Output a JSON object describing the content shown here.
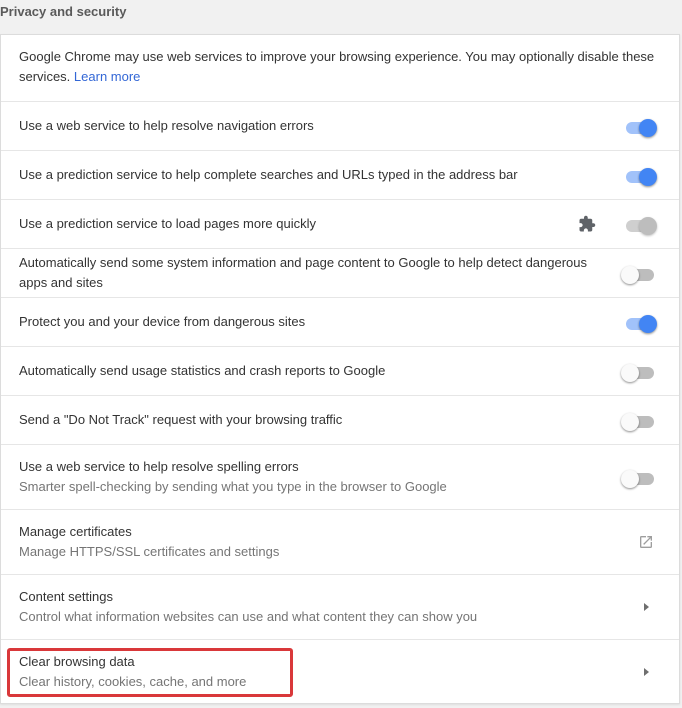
{
  "section": {
    "title": "Privacy and security"
  },
  "intro": {
    "text": "Google Chrome may use web services to improve your browsing experience. You may optionally disable these services.",
    "link": "Learn more"
  },
  "settings": [
    {
      "label": "Use a web service to help resolve navigation errors",
      "state": "on"
    },
    {
      "label": "Use a prediction service to help complete searches and URLs typed in the address bar",
      "state": "on"
    },
    {
      "label": "Use a prediction service to load pages more quickly",
      "state": "on",
      "controlled_by_extension": true
    },
    {
      "label": "Automatically send some system information and page content to Google to help detect dangerous apps and sites",
      "state": "off"
    },
    {
      "label": "Protect you and your device from dangerous sites",
      "state": "on"
    },
    {
      "label": "Automatically send usage statistics and crash reports to Google",
      "state": "off"
    },
    {
      "label": "Send a \"Do Not Track\" request with your browsing traffic",
      "state": "off"
    },
    {
      "label": "Use a web service to help resolve spelling errors",
      "sublabel": "Smarter spell-checking by sending what you type in the browser to Google",
      "state": "off"
    }
  ],
  "links": {
    "certificates": {
      "label": "Manage certificates",
      "sublabel": "Manage HTTPS/SSL certificates and settings",
      "icon": "external-link-icon"
    },
    "content_settings": {
      "label": "Content settings",
      "sublabel": "Control what information websites can use and what content they can show you",
      "icon": "chevron-right-icon"
    },
    "clear_data": {
      "label": "Clear browsing data",
      "sublabel": "Clear history, cookies, cache, and more",
      "icon": "chevron-right-icon",
      "highlighted": true
    }
  },
  "colors": {
    "toggle_on": "#4285f4",
    "toggle_on_track": "#a1c2fa",
    "link": "#3367d6",
    "highlight": "#d9383a"
  }
}
